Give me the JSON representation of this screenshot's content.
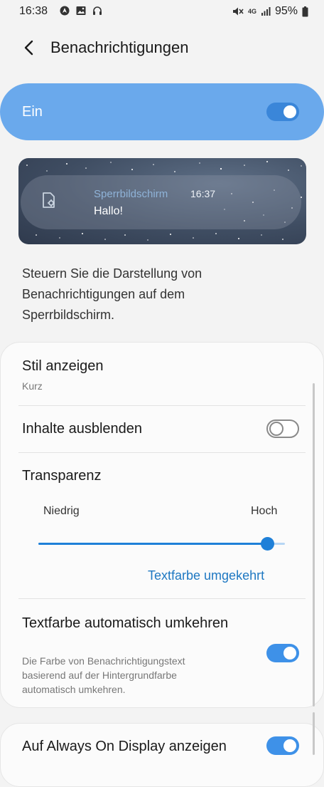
{
  "status_bar": {
    "time": "16:38",
    "left_icons": [
      "navigation-icon",
      "image-icon",
      "headphones-icon"
    ],
    "right_icons": [
      "mute-vibrate-icon",
      "network-4g-icon",
      "signal-icon"
    ],
    "network": "4G",
    "battery": "95%"
  },
  "header": {
    "title": "Benachrichtigungen",
    "back_icon": "chevron-left-icon"
  },
  "master_switch": {
    "label": "Ein",
    "enabled": true
  },
  "preview": {
    "app_name": "Sperrbildschirm",
    "time": "16:37",
    "message": "Hallo!",
    "icon": "settings-document-icon"
  },
  "description": "Steuern Sie die Darstellung von Benachrichtigungen auf dem Sperrbildschirm.",
  "settings": {
    "style": {
      "title": "Stil anzeigen",
      "value": "Kurz"
    },
    "hide_content": {
      "title": "Inhalte ausblenden",
      "enabled": false
    },
    "transparency": {
      "title": "Transparenz",
      "low_label": "Niedrig",
      "high_label": "Hoch",
      "level": 0.93
    },
    "invert_link": "Textfarbe umgekehrt",
    "auto_invert": {
      "title": "Textfarbe automatisch umkehren",
      "description": "Die Farbe von Benachrichtigungstext basierend auf der Hintergrundfarbe automatisch umkehren.",
      "enabled": true
    },
    "always_on_display": {
      "title": "Auf Always On Display anzeigen",
      "enabled": true
    }
  },
  "colors": {
    "accent": "#3e91e8",
    "master_bg": "#6aa9ec",
    "link": "#1e78c2",
    "background": "#f3f3f3"
  }
}
